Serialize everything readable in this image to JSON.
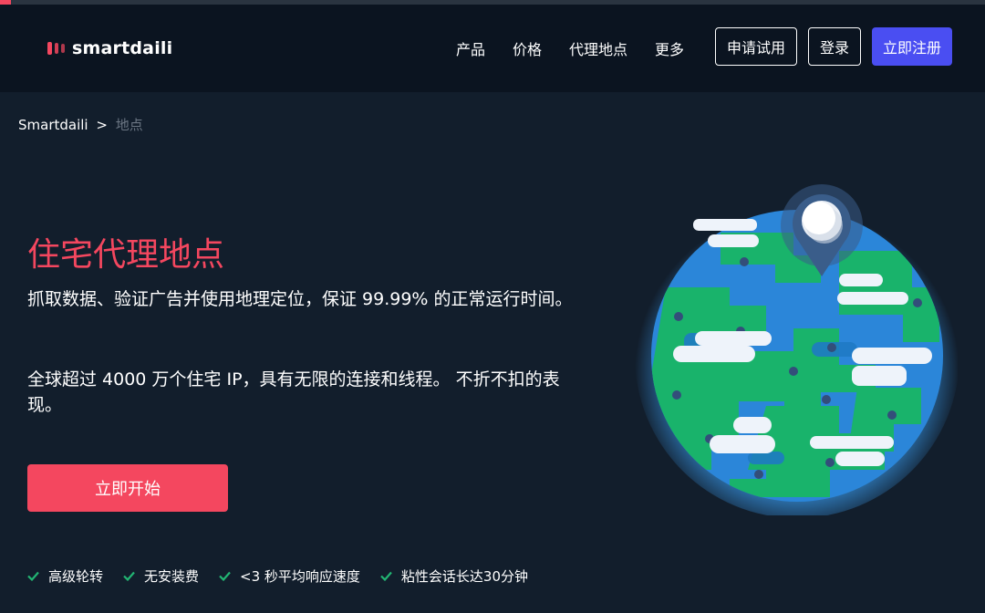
{
  "brand": {
    "name": "smartdaili",
    "accent": "#f4475f",
    "primary": "#4a4ef2",
    "bg": "#121e2c"
  },
  "nav": {
    "items": [
      "产品",
      "价格",
      "代理地点",
      "更多"
    ]
  },
  "header": {
    "trial_label": "申请试用",
    "login_label": "登录",
    "register_label": "立即注册"
  },
  "breadcrumb": {
    "home": "Smartdaili",
    "separator": ">",
    "current": "地点"
  },
  "hero": {
    "title": "住宅代理地点",
    "desc1": "抓取数据、验证广告并使用地理定位，保证 99.99% 的正常运行时间。",
    "desc2": "全球超过 4000 万个住宅 IP，具有无限的连接和线程。 不折不扣的表现。",
    "cta_label": "立即开始"
  },
  "features": [
    "高级轮转",
    "无安装费",
    "<3 秒平均响应速度",
    "粘性会话长达30分钟"
  ],
  "icons": {
    "logo": "smartdaili-logo-icon",
    "check": "check-icon",
    "globe": "globe-illustration"
  }
}
